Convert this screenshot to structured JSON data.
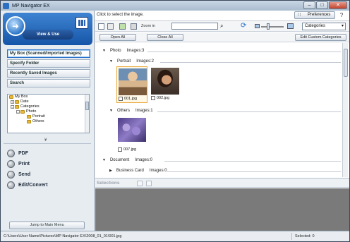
{
  "window": {
    "title": "MP Navigator EX",
    "min_label": "–",
    "max_label": "□",
    "close_label": "✕"
  },
  "left_panel": {
    "mode_button": "View & Use",
    "nav_items": [
      {
        "label": "My Box (Scanned/Imported Images)",
        "active": true
      },
      {
        "label": "Specify Folder",
        "active": false
      },
      {
        "label": "Recently Saved Images",
        "active": false
      },
      {
        "label": "Search",
        "active": false
      }
    ],
    "tree": [
      {
        "label": "My Box",
        "level": 0,
        "exp": ""
      },
      {
        "label": "Date",
        "level": 1,
        "exp": "+"
      },
      {
        "label": "Categories",
        "level": 1,
        "exp": "–"
      },
      {
        "label": "Photo",
        "level": 2,
        "exp": "–"
      },
      {
        "label": "Portrait",
        "level": 3,
        "exp": ""
      },
      {
        "label": "Others",
        "level": 3,
        "exp": ""
      }
    ],
    "collapse_label": "¥",
    "actions": [
      "PDF",
      "Print",
      "Send",
      "Edit/Convert"
    ],
    "jump_button": "Jump to Main Menu"
  },
  "main": {
    "instruction": "Click to select the image.",
    "preferences_button": "Preferences",
    "help_button": "?",
    "zoom_label": "Zoom in",
    "category_select": "Categories",
    "open_all": "Open All",
    "close_all": "Close All",
    "edit_categories": "Edit Custom Categories",
    "groups": {
      "photo": {
        "label": "Photo",
        "count": "Images:3"
      },
      "portrait": {
        "label": "Portrait",
        "count": "Images:2"
      },
      "others": {
        "label": "Others",
        "count": "Images:1"
      },
      "document": {
        "label": "Document",
        "count": "Images:0"
      },
      "business_card": {
        "label": "Business Card",
        "count": "Images:0"
      }
    },
    "thumbnails": [
      {
        "file": "001.jpg",
        "selected": true
      },
      {
        "file": "002.jpg",
        "selected": false
      },
      {
        "file": "007.jpg",
        "selected": false
      }
    ],
    "selections_label": "Selections"
  },
  "status": {
    "path": "C:\\Users\\User Name\\Pictures\\MP Navigator EX\\2008_01_01\\001.jpg",
    "selected": "Selected: 0"
  }
}
